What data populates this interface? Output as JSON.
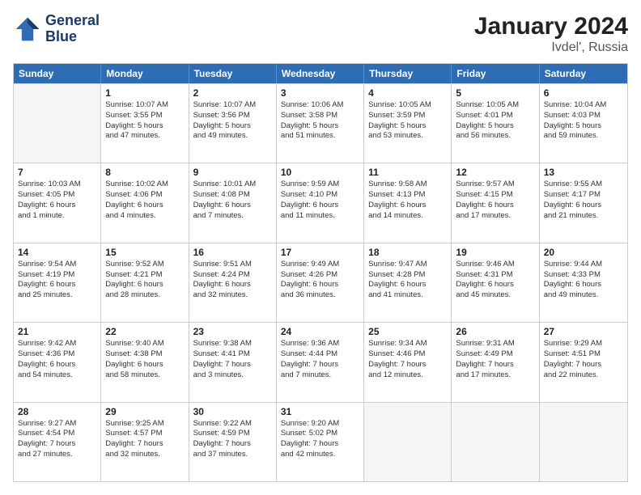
{
  "logo": {
    "line1": "General",
    "line2": "Blue"
  },
  "title": "January 2024",
  "subtitle": "Ivdel', Russia",
  "days_of_week": [
    "Sunday",
    "Monday",
    "Tuesday",
    "Wednesday",
    "Thursday",
    "Friday",
    "Saturday"
  ],
  "weeks": [
    [
      {
        "day": "",
        "empty": true
      },
      {
        "day": "1",
        "lines": [
          "Sunrise: 10:07 AM",
          "Sunset: 3:55 PM",
          "Daylight: 5 hours",
          "and 47 minutes."
        ]
      },
      {
        "day": "2",
        "lines": [
          "Sunrise: 10:07 AM",
          "Sunset: 3:56 PM",
          "Daylight: 5 hours",
          "and 49 minutes."
        ]
      },
      {
        "day": "3",
        "lines": [
          "Sunrise: 10:06 AM",
          "Sunset: 3:58 PM",
          "Daylight: 5 hours",
          "and 51 minutes."
        ]
      },
      {
        "day": "4",
        "lines": [
          "Sunrise: 10:05 AM",
          "Sunset: 3:59 PM",
          "Daylight: 5 hours",
          "and 53 minutes."
        ]
      },
      {
        "day": "5",
        "lines": [
          "Sunrise: 10:05 AM",
          "Sunset: 4:01 PM",
          "Daylight: 5 hours",
          "and 56 minutes."
        ]
      },
      {
        "day": "6",
        "lines": [
          "Sunrise: 10:04 AM",
          "Sunset: 4:03 PM",
          "Daylight: 5 hours",
          "and 59 minutes."
        ]
      }
    ],
    [
      {
        "day": "7",
        "lines": [
          "Sunrise: 10:03 AM",
          "Sunset: 4:05 PM",
          "Daylight: 6 hours",
          "and 1 minute."
        ]
      },
      {
        "day": "8",
        "lines": [
          "Sunrise: 10:02 AM",
          "Sunset: 4:06 PM",
          "Daylight: 6 hours",
          "and 4 minutes."
        ]
      },
      {
        "day": "9",
        "lines": [
          "Sunrise: 10:01 AM",
          "Sunset: 4:08 PM",
          "Daylight: 6 hours",
          "and 7 minutes."
        ]
      },
      {
        "day": "10",
        "lines": [
          "Sunrise: 9:59 AM",
          "Sunset: 4:10 PM",
          "Daylight: 6 hours",
          "and 11 minutes."
        ]
      },
      {
        "day": "11",
        "lines": [
          "Sunrise: 9:58 AM",
          "Sunset: 4:13 PM",
          "Daylight: 6 hours",
          "and 14 minutes."
        ]
      },
      {
        "day": "12",
        "lines": [
          "Sunrise: 9:57 AM",
          "Sunset: 4:15 PM",
          "Daylight: 6 hours",
          "and 17 minutes."
        ]
      },
      {
        "day": "13",
        "lines": [
          "Sunrise: 9:55 AM",
          "Sunset: 4:17 PM",
          "Daylight: 6 hours",
          "and 21 minutes."
        ]
      }
    ],
    [
      {
        "day": "14",
        "lines": [
          "Sunrise: 9:54 AM",
          "Sunset: 4:19 PM",
          "Daylight: 6 hours",
          "and 25 minutes."
        ]
      },
      {
        "day": "15",
        "lines": [
          "Sunrise: 9:52 AM",
          "Sunset: 4:21 PM",
          "Daylight: 6 hours",
          "and 28 minutes."
        ]
      },
      {
        "day": "16",
        "lines": [
          "Sunrise: 9:51 AM",
          "Sunset: 4:24 PM",
          "Daylight: 6 hours",
          "and 32 minutes."
        ]
      },
      {
        "day": "17",
        "lines": [
          "Sunrise: 9:49 AM",
          "Sunset: 4:26 PM",
          "Daylight: 6 hours",
          "and 36 minutes."
        ]
      },
      {
        "day": "18",
        "lines": [
          "Sunrise: 9:47 AM",
          "Sunset: 4:28 PM",
          "Daylight: 6 hours",
          "and 41 minutes."
        ]
      },
      {
        "day": "19",
        "lines": [
          "Sunrise: 9:46 AM",
          "Sunset: 4:31 PM",
          "Daylight: 6 hours",
          "and 45 minutes."
        ]
      },
      {
        "day": "20",
        "lines": [
          "Sunrise: 9:44 AM",
          "Sunset: 4:33 PM",
          "Daylight: 6 hours",
          "and 49 minutes."
        ]
      }
    ],
    [
      {
        "day": "21",
        "lines": [
          "Sunrise: 9:42 AM",
          "Sunset: 4:36 PM",
          "Daylight: 6 hours",
          "and 54 minutes."
        ]
      },
      {
        "day": "22",
        "lines": [
          "Sunrise: 9:40 AM",
          "Sunset: 4:38 PM",
          "Daylight: 6 hours",
          "and 58 minutes."
        ]
      },
      {
        "day": "23",
        "lines": [
          "Sunrise: 9:38 AM",
          "Sunset: 4:41 PM",
          "Daylight: 7 hours",
          "and 3 minutes."
        ]
      },
      {
        "day": "24",
        "lines": [
          "Sunrise: 9:36 AM",
          "Sunset: 4:44 PM",
          "Daylight: 7 hours",
          "and 7 minutes."
        ]
      },
      {
        "day": "25",
        "lines": [
          "Sunrise: 9:34 AM",
          "Sunset: 4:46 PM",
          "Daylight: 7 hours",
          "and 12 minutes."
        ]
      },
      {
        "day": "26",
        "lines": [
          "Sunrise: 9:31 AM",
          "Sunset: 4:49 PM",
          "Daylight: 7 hours",
          "and 17 minutes."
        ]
      },
      {
        "day": "27",
        "lines": [
          "Sunrise: 9:29 AM",
          "Sunset: 4:51 PM",
          "Daylight: 7 hours",
          "and 22 minutes."
        ]
      }
    ],
    [
      {
        "day": "28",
        "lines": [
          "Sunrise: 9:27 AM",
          "Sunset: 4:54 PM",
          "Daylight: 7 hours",
          "and 27 minutes."
        ]
      },
      {
        "day": "29",
        "lines": [
          "Sunrise: 9:25 AM",
          "Sunset: 4:57 PM",
          "Daylight: 7 hours",
          "and 32 minutes."
        ]
      },
      {
        "day": "30",
        "lines": [
          "Sunrise: 9:22 AM",
          "Sunset: 4:59 PM",
          "Daylight: 7 hours",
          "and 37 minutes."
        ]
      },
      {
        "day": "31",
        "lines": [
          "Sunrise: 9:20 AM",
          "Sunset: 5:02 PM",
          "Daylight: 7 hours",
          "and 42 minutes."
        ]
      },
      {
        "day": "",
        "empty": true
      },
      {
        "day": "",
        "empty": true
      },
      {
        "day": "",
        "empty": true
      }
    ]
  ]
}
